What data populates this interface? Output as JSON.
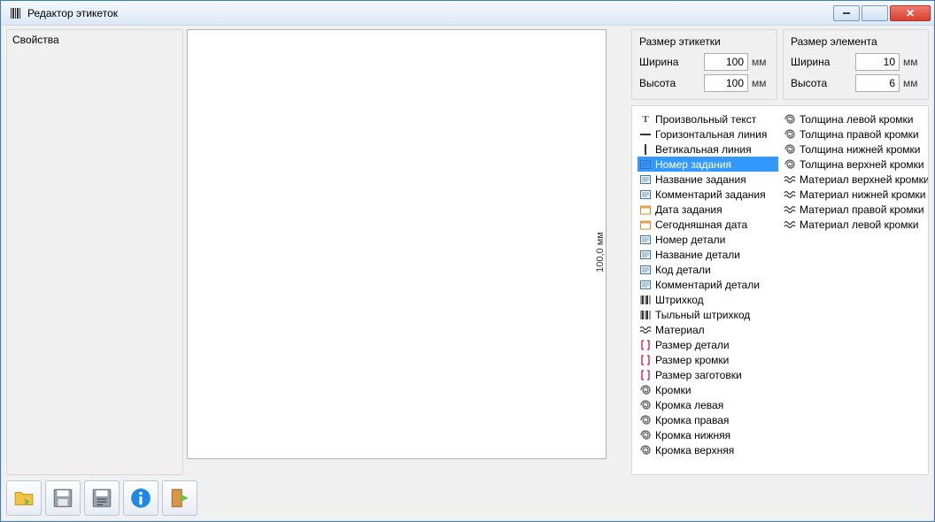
{
  "window": {
    "title": "Редактор этикеток"
  },
  "props": {
    "title": "Свойства"
  },
  "canvas": {
    "ruler_text": "100,0 мм"
  },
  "label_size": {
    "title": "Размер этикетки",
    "width_label": "Ширина",
    "width_value": "100",
    "height_label": "Высота",
    "height_value": "100",
    "unit": "мм"
  },
  "element_size": {
    "title": "Размер элемента",
    "width_label": "Ширина",
    "width_value": "10",
    "height_label": "Высота",
    "height_value": "6",
    "unit": "мм"
  },
  "elements_left": [
    {
      "label": "Произвольный текст",
      "icon": "text",
      "selected": false
    },
    {
      "label": "Горизонтальная линия",
      "icon": "hline",
      "selected": false
    },
    {
      "label": "Ветикальная линия",
      "icon": "vline",
      "selected": false
    },
    {
      "label": "Номер задания",
      "icon": "box",
      "selected": true
    },
    {
      "label": "Название задания",
      "icon": "box",
      "selected": false
    },
    {
      "label": "Комментарий задания",
      "icon": "box",
      "selected": false
    },
    {
      "label": "Дата задания",
      "icon": "cal",
      "selected": false
    },
    {
      "label": "Сегодняшная дата",
      "icon": "cal",
      "selected": false
    },
    {
      "label": "Номер детали",
      "icon": "box",
      "selected": false
    },
    {
      "label": "Название детали",
      "icon": "box",
      "selected": false
    },
    {
      "label": "Код детали",
      "icon": "box",
      "selected": false
    },
    {
      "label": "Комментарий детали",
      "icon": "box",
      "selected": false
    },
    {
      "label": "Штрихкод",
      "icon": "barcode",
      "selected": false
    },
    {
      "label": "Тыльный штрихкод",
      "icon": "barcode",
      "selected": false
    },
    {
      "label": "Материал",
      "icon": "wave",
      "selected": false
    },
    {
      "label": "Размер детали",
      "icon": "bracket",
      "selected": false
    },
    {
      "label": "Размер кромки",
      "icon": "bracket",
      "selected": false
    },
    {
      "label": "Размер заготовки",
      "icon": "bracket",
      "selected": false
    },
    {
      "label": "Кромки",
      "icon": "spiral",
      "selected": false
    },
    {
      "label": "Кромка левая",
      "icon": "spiral",
      "selected": false
    },
    {
      "label": "Кромка правая",
      "icon": "spiral",
      "selected": false
    },
    {
      "label": "Кромка нижняя",
      "icon": "spiral",
      "selected": false
    },
    {
      "label": "Кромка верхняя",
      "icon": "spiral",
      "selected": false
    }
  ],
  "elements_right": [
    {
      "label": "Толщина левой кромки",
      "icon": "spiral"
    },
    {
      "label": "Толщина правой кромки",
      "icon": "spiral"
    },
    {
      "label": "Толщина нижней кромки",
      "icon": "spiral"
    },
    {
      "label": "Толщина верхней кромки",
      "icon": "spiral"
    },
    {
      "label": "Материал верхней кромки",
      "icon": "wave"
    },
    {
      "label": "Материал нижней кромки",
      "icon": "wave"
    },
    {
      "label": "Материал правой кромки",
      "icon": "wave"
    },
    {
      "label": "Материал левой кромки",
      "icon": "wave"
    }
  ],
  "toolbar": {
    "open": "open",
    "save": "save",
    "save_as": "save_as",
    "info": "info",
    "exit": "exit"
  }
}
